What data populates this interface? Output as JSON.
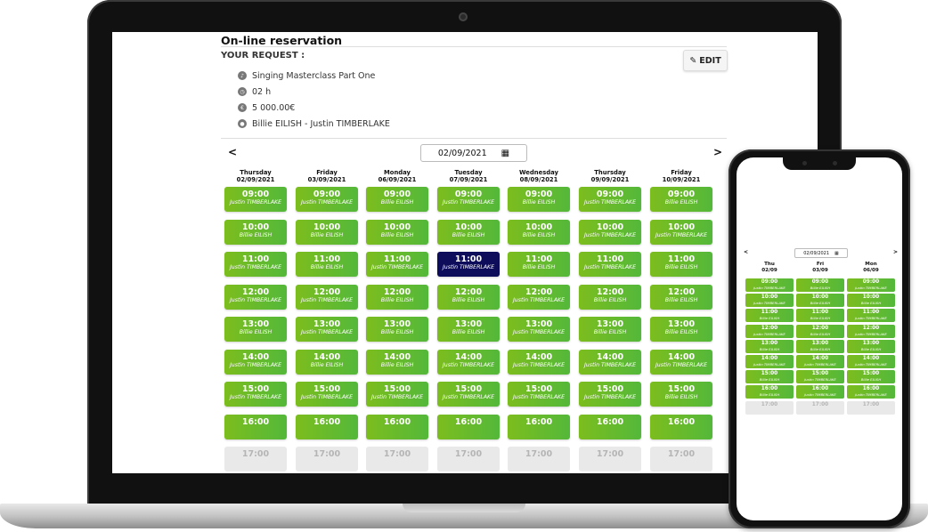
{
  "page": {
    "title": "On-line reservation",
    "request_label": "YOUR REQUEST :",
    "edit_label": "EDIT"
  },
  "request": [
    {
      "icon": "music-note-icon",
      "text": "Singing Masterclass Part One"
    },
    {
      "icon": "clock-icon",
      "text": "02 h"
    },
    {
      "icon": "price-tag-icon",
      "text": "5 000.00€"
    },
    {
      "icon": "user-icon",
      "text": "Billie EILISH - Justin TIMBERLAKE"
    }
  ],
  "calendar": {
    "date_value": "02/09/2021",
    "prev_label": "<",
    "next_label": ">",
    "days": [
      {
        "name": "Thursday",
        "date": "02/09/2021"
      },
      {
        "name": "Friday",
        "date": "03/09/2021"
      },
      {
        "name": "Monday",
        "date": "06/09/2021"
      },
      {
        "name": "Tuesday",
        "date": "07/09/2021"
      },
      {
        "name": "Wednesday",
        "date": "08/09/2021"
      },
      {
        "name": "Thursday",
        "date": "09/09/2021"
      },
      {
        "name": "Friday",
        "date": "10/09/2021"
      }
    ],
    "times": [
      "09:00",
      "10:00",
      "11:00",
      "12:00",
      "13:00",
      "14:00",
      "15:00",
      "16:00",
      "17:00"
    ],
    "grid": [
      [
        "Justin TIMBERLAKE",
        "Billie EILISH",
        "Justin TIMBERLAKE",
        "Justin TIMBERLAKE",
        "Billie EILISH",
        "Justin TIMBERLAKE",
        "Justin TIMBERLAKE",
        ""
      ],
      [
        "Justin TIMBERLAKE",
        "Billie EILISH",
        "Billie EILISH",
        "Justin TIMBERLAKE",
        "Justin TIMBERLAKE",
        "Billie EILISH",
        "Justin TIMBERLAKE",
        ""
      ],
      [
        "Billie EILISH",
        "Billie EILISH",
        "Justin TIMBERLAKE",
        "Billie EILISH",
        "Billie EILISH",
        "Billie EILISH",
        "Justin TIMBERLAKE",
        ""
      ],
      [
        "Justin TIMBERLAKE",
        "Billie EILISH",
        "Justin TIMBERLAKE",
        "Billie EILISH",
        "Billie EILISH",
        "Justin TIMBERLAKE",
        "Justin TIMBERLAKE",
        ""
      ],
      [
        "Billie EILISH",
        "Billie EILISH",
        "Billie EILISH",
        "Justin TIMBERLAKE",
        "Justin TIMBERLAKE",
        "Justin TIMBERLAKE",
        "Justin TIMBERLAKE",
        ""
      ],
      [
        "Justin TIMBERLAKE",
        "Justin TIMBERLAKE",
        "Justin TIMBERLAKE",
        "Billie EILISH",
        "Billie EILISH",
        "Justin TIMBERLAKE",
        "Justin TIMBERLAKE",
        ""
      ],
      [
        "Billie EILISH",
        "Justin TIMBERLAKE",
        "Billie EILISH",
        "Billie EILISH",
        "Billie EILISH",
        "Justin TIMBERLAKE",
        "Billie EILISH",
        ""
      ]
    ],
    "selected": {
      "day": 3,
      "time": 2
    },
    "disabled_time": 8
  },
  "phone": {
    "date_value": "02/09/2021",
    "days": [
      {
        "name": "Thu",
        "date": "02/09"
      },
      {
        "name": "Fri",
        "date": "03/09"
      },
      {
        "name": "Mon",
        "date": "06/09"
      }
    ],
    "times": [
      "09:00",
      "10:00",
      "11:00",
      "12:00",
      "13:00",
      "14:00",
      "15:00",
      "16:00",
      "17:00"
    ],
    "grid": [
      [
        "Justin TIMBERLAKE",
        "Justin TIMBERLAKE",
        "Billie EILISH",
        "Justin TIMBERLAKE",
        "Billie EILISH",
        "Justin TIMBERLAKE",
        "Billie EILISH",
        "Billie EILISH",
        ""
      ],
      [
        "Billie EILISH",
        "Billie EILISH",
        "Billie EILISH",
        "Billie EILISH",
        "Billie EILISH",
        "Justin TIMBERLAKE",
        "Justin TIMBERLAKE",
        "Justin TIMBERLAKE",
        ""
      ],
      [
        "Justin TIMBERLAKE",
        "Billie EILISH",
        "Justin TIMBERLAKE",
        "Justin TIMBERLAKE",
        "Billie EILISH",
        "Justin TIMBERLAKE",
        "Billie EILISH",
        "Justin TIMBERLAKE",
        ""
      ]
    ]
  }
}
